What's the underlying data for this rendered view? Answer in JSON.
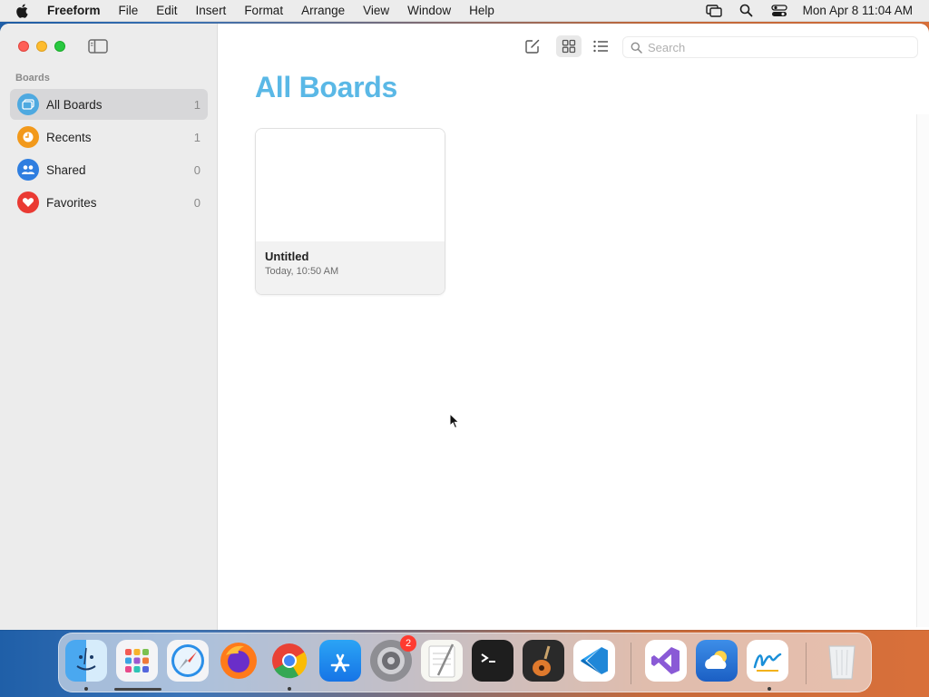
{
  "menubar": {
    "app_name": "Freeform",
    "items": [
      "File",
      "Edit",
      "Insert",
      "Format",
      "Arrange",
      "View",
      "Window",
      "Help"
    ],
    "clock": "Mon Apr 8  11:04 AM"
  },
  "sidebar": {
    "heading": "Boards",
    "items": [
      {
        "label": "All Boards",
        "count": "1",
        "icon": "all-boards-icon",
        "color": "#4ea9e0"
      },
      {
        "label": "Recents",
        "count": "1",
        "icon": "clock-icon",
        "color": "#f2991b"
      },
      {
        "label": "Shared",
        "count": "0",
        "icon": "people-icon",
        "color": "#2f7ee0"
      },
      {
        "label": "Favorites",
        "count": "0",
        "icon": "heart-icon",
        "color": "#ea3a33"
      }
    ]
  },
  "toolbar": {
    "search_placeholder": "Search"
  },
  "content": {
    "title": "All Boards",
    "boards": [
      {
        "name": "Untitled",
        "date": "Today, 10:50 AM"
      }
    ]
  },
  "dock": {
    "settings_badge": "2",
    "apps": [
      "finder",
      "launchpad",
      "safari",
      "firefox",
      "chrome",
      "app-store",
      "system-settings",
      "textedit",
      "terminal",
      "garageband",
      "vscode",
      "visual-studio",
      "weather",
      "freeform",
      "trash"
    ]
  },
  "colors": {
    "title_blue": "#5ab8e6",
    "selected_row": "#d7d7d9"
  }
}
